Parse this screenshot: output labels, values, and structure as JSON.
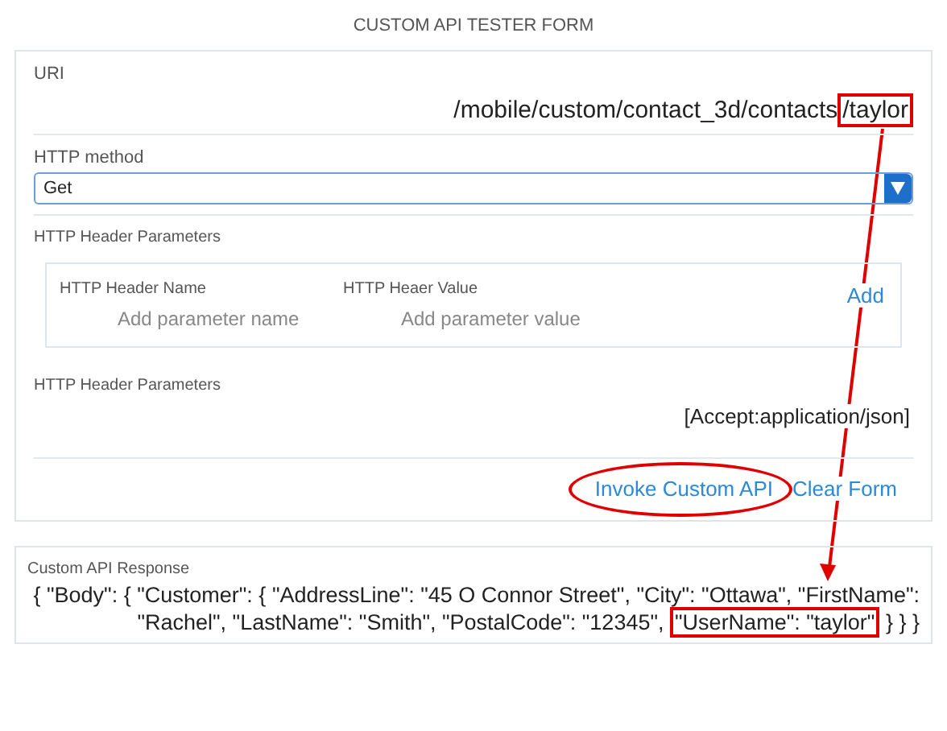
{
  "title": "CUSTOM API TESTER FORM",
  "uri": {
    "label": "URI",
    "value_path": "/mobile/custom/contact_3d/contacts",
    "value_highlight": "/taylor"
  },
  "http_method": {
    "label": "HTTP method",
    "value": "Get"
  },
  "header_parameters": {
    "label": "HTTP Header Parameters",
    "name_label": "HTTP Header Name",
    "value_label": "HTTP Heaer Value",
    "name_placeholder": "Add parameter name",
    "value_placeholder": "Add parameter value",
    "add": "Add"
  },
  "current_headers": {
    "label": "HTTP Header Parameters",
    "value": "[Accept:application/json]"
  },
  "buttons": [
    {
      "label": "Invoke Custom API",
      "highlighted": true
    },
    {
      "label": "Clear Form",
      "highlighted": false
    }
  ],
  "response": {
    "label": "Custom API Response",
    "text_before": "{ \"Body\": { \"Customer\": { \"AddressLine\": \"45 O Connor Street\", \"City\": \"Ottawa\", \"FirstName\": \"Rachel\", \"LastName\": \"Smith\", \"PostalCode\": \"12345\", ",
    "highlight": "\"UserName\": \"taylor\"",
    "text_after": " } } }"
  }
}
